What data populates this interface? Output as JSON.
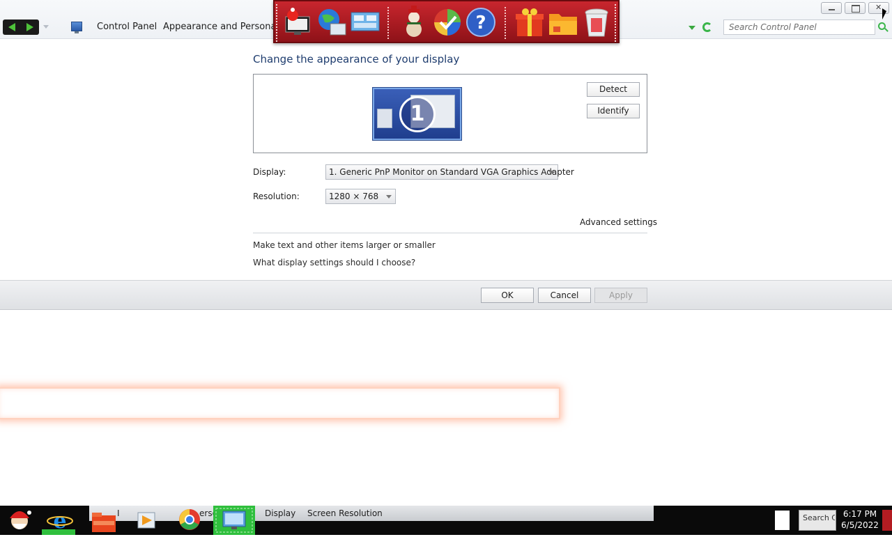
{
  "window": {
    "breadcrumb": [
      "Control Panel",
      "Appearance and Personalization"
    ],
    "search_placeholder": "Search Control Panel"
  },
  "dock": {
    "items": [
      "santa-screen-icon",
      "globe-computer-icon",
      "network-icon",
      "snowman-icon",
      "shield-icon",
      "help-icon",
      "gift-icon",
      "folder-icon",
      "recycle-bin-icon"
    ]
  },
  "content": {
    "heading": "Change the appearance of your display",
    "monitor_number": "1",
    "detect_label": "Detect",
    "identify_label": "Identify",
    "display_label": "Display:",
    "display_value": "1. Generic PnP Monitor on Standard VGA Graphics Adapter",
    "resolution_label": "Resolution:",
    "resolution_value": "1280 × 768",
    "advanced_link": "Advanced settings",
    "link_larger": "Make text and other items larger or smaller",
    "link_choose": "What display settings should I choose?"
  },
  "commands": {
    "ok": "OK",
    "cancel": "Cancel",
    "apply": "Apply"
  },
  "taskbar": {
    "partial_a": "I",
    "partial_b": "erso",
    "display": "Display",
    "screen_resolution": "Screen Resolution",
    "tray_text": "Search Co",
    "time": "6:17 PM",
    "date": "6/5/2022"
  }
}
